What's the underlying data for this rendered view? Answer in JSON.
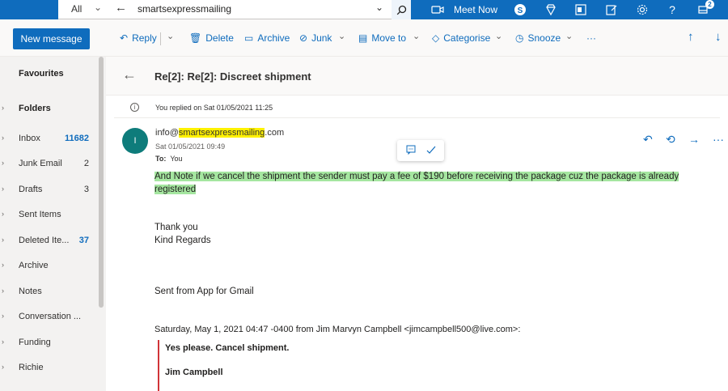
{
  "search": {
    "scope": "All",
    "query": "smartsexpressmailing"
  },
  "topbar": {
    "meet_now": "Meet Now",
    "notifications_count": "2"
  },
  "toolbar": {
    "new_message": "New message",
    "reply": "Reply",
    "delete": "Delete",
    "archive": "Archive",
    "junk": "Junk",
    "move_to": "Move to",
    "categorise": "Categorise",
    "snooze": "Snooze",
    "more": "···"
  },
  "sidebar": {
    "favourites": "Favourites",
    "folders": "Folders",
    "items": [
      {
        "label": "Inbox",
        "count": "11682"
      },
      {
        "label": "Junk Email",
        "count": "2"
      },
      {
        "label": "Drafts",
        "count": "3"
      },
      {
        "label": "Sent Items",
        "count": ""
      },
      {
        "label": "Deleted Ite...",
        "count": "37"
      },
      {
        "label": "Archive",
        "count": ""
      },
      {
        "label": "Notes",
        "count": ""
      },
      {
        "label": "Conversation ...",
        "count": ""
      },
      {
        "label": "Funding",
        "count": ""
      },
      {
        "label": "Richie",
        "count": ""
      }
    ]
  },
  "message": {
    "subject": "Re[2]: Re[2]: Discreet shipment",
    "replied_notice": "You replied on Sat 01/05/2021 11:25",
    "avatar_initial": "I",
    "sender_prefix": "info@",
    "sender_highlight": "smartsexpressmailing",
    "sender_suffix": ".com",
    "date": "Sat 01/05/2021 09:49",
    "to_label": "To:",
    "to_value": "You",
    "body_line1": "And Note if we cancel the shipment the sender must pay a fee of $190 before receiving the package cuz the package is already",
    "body_line2": "registered",
    "thanks": "Thank you",
    "regards": "Kind Regards",
    "signature": "Sent from App for Gmail",
    "quote_header": "Saturday, May 1, 2021 04:47 -0400 from Jim Marvyn Campbell <jimcampbell500@live.com>:",
    "quote_line1": "Yes please. Cancel shipment.",
    "quote_line2": "Jim Campbell"
  },
  "colors": {
    "brand": "#0f6cbd",
    "avatar": "#0e7c7b",
    "highlight_yellow": "#fff100",
    "highlight_green": "#a5e6a0",
    "quote_bar": "#d13438"
  }
}
